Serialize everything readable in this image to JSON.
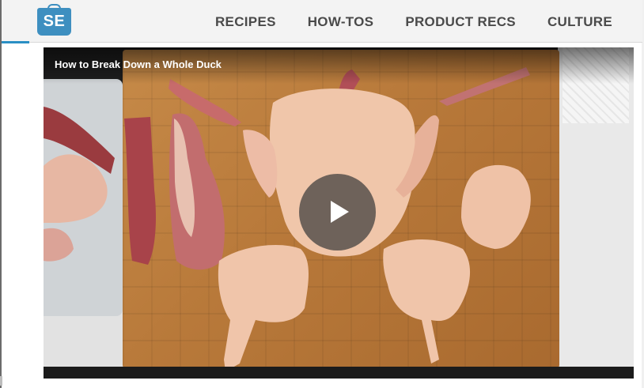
{
  "site": {
    "logo_text": "SE"
  },
  "nav": {
    "items": [
      "RECIPES",
      "HOW-TOS",
      "PRODUCT RECS",
      "CULTURE"
    ]
  },
  "video": {
    "title": "How to Break Down a Whole Duck",
    "play_icon": "play-icon"
  },
  "colors": {
    "accent": "#3e8fc0",
    "nav_text": "#4a4a4a",
    "header_bg": "#f3f3f3"
  }
}
